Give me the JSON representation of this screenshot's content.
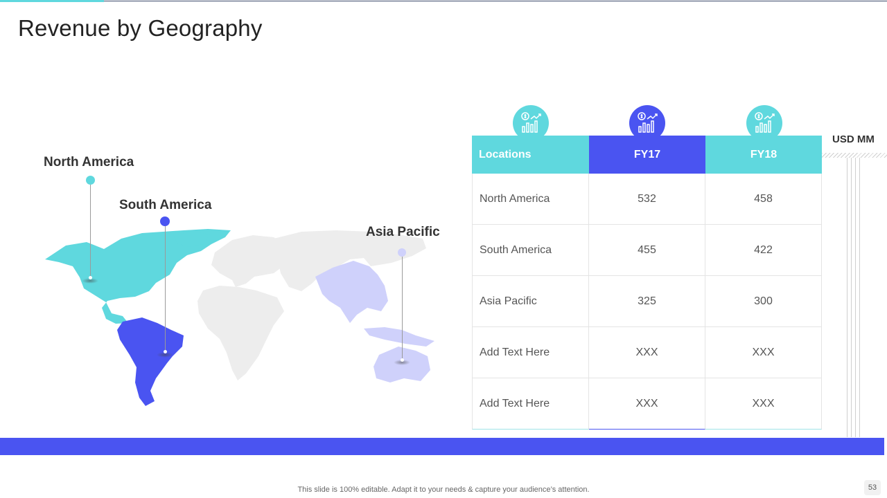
{
  "slide": {
    "title": "Revenue by Geography",
    "footer_note": "This slide is 100% editable. Adapt it to your needs & capture your audience’s attention.",
    "page_number": "53"
  },
  "colors": {
    "teal": "#5fd8de",
    "blue": "#4a54f1",
    "lavender": "#cfd1fb",
    "gray_land": "#ededed"
  },
  "map": {
    "labels": {
      "north_america": "North America",
      "south_america": "South America",
      "asia_pacific": "Asia Pacific"
    }
  },
  "table": {
    "unit": "USD MM",
    "headers": [
      "Locations",
      "FY17",
      "FY18"
    ],
    "header_icons": [
      "revenue-growth-icon",
      "revenue-growth-icon",
      "revenue-growth-icon"
    ],
    "rows": [
      [
        "North America",
        "532",
        "458"
      ],
      [
        "South America",
        "455",
        "422"
      ],
      [
        "Asia Pacific",
        "325",
        "300"
      ],
      [
        "Add Text Here",
        "XXX",
        "XXX"
      ],
      [
        "Add Text Here",
        "XXX",
        "XXX"
      ]
    ]
  }
}
